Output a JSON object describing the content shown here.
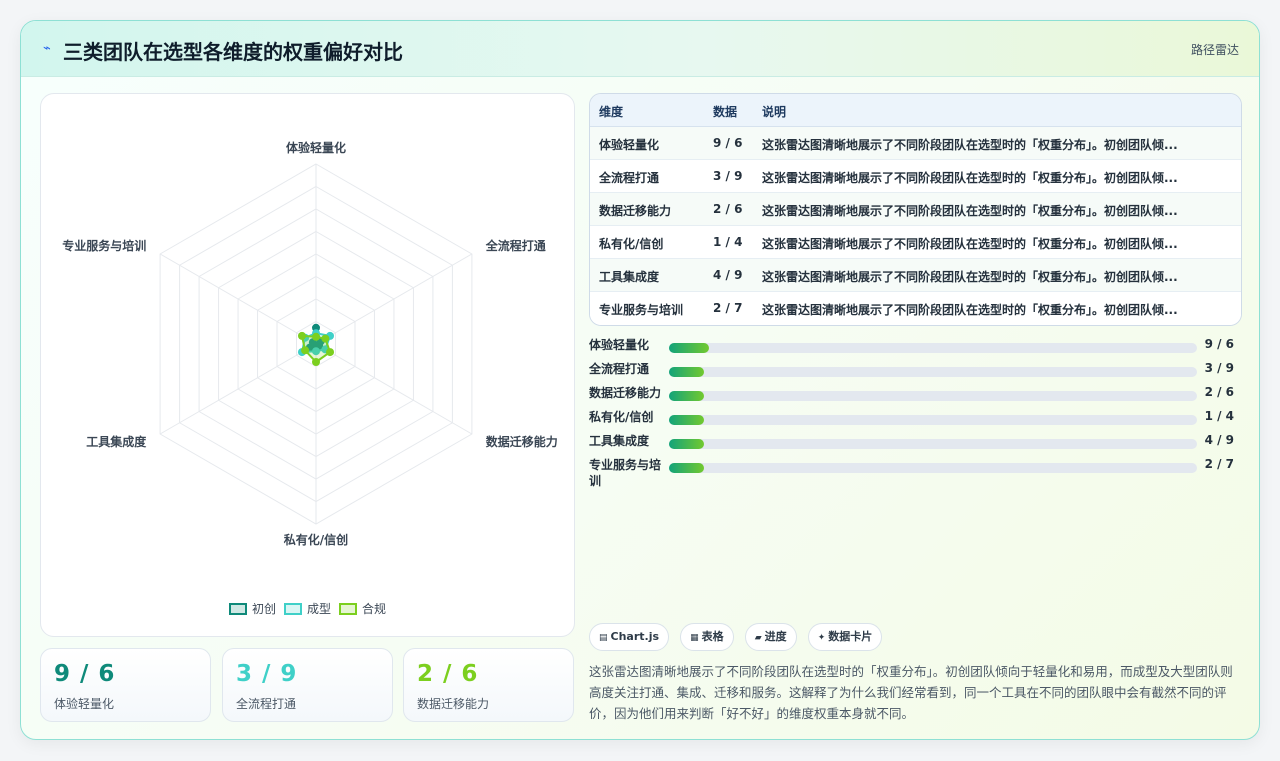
{
  "header": {
    "logo": "⌁",
    "title": "三类团队在选型各维度的权重偏好对比",
    "tag": "路径雷达"
  },
  "colors": {
    "accent": "#0f9d8a",
    "series": [
      "#0f8a7a",
      "#3fd0c8",
      "#7ccf1f"
    ]
  },
  "chart_data": {
    "type": "radar",
    "labels": [
      "体验轻量化",
      "全流程打通",
      "数据迁移能力",
      "私有化/信创",
      "工具集成度",
      "专业服务与培训"
    ],
    "series": [
      {
        "name": "初创",
        "values": [
          9,
          3,
          2,
          1,
          4,
          2
        ]
      },
      {
        "name": "成型",
        "values": [
          6,
          9,
          6,
          4,
          9,
          7
        ]
      },
      {
        "name": "合规",
        "values": [
          4,
          6,
          9,
          10,
          7,
          9
        ]
      }
    ],
    "r_range": [
      0,
      100
    ],
    "grid_levels": 8,
    "legend_position": "bottom"
  },
  "stats": [
    {
      "value": "9 / 6",
      "label": "体验轻量化"
    },
    {
      "value": "3 / 9",
      "label": "全流程打通"
    },
    {
      "value": "2 / 6",
      "label": "数据迁移能力"
    }
  ],
  "table": {
    "headers": [
      "维度",
      "数据",
      "说明"
    ],
    "rows": [
      {
        "dim": "体验轻量化",
        "data": "9 / 6",
        "note": "这张雷达图清晰地展示了不同阶段团队在选型时的「权重分布」。初创团队倾..."
      },
      {
        "dim": "全流程打通",
        "data": "3 / 9",
        "note": "这张雷达图清晰地展示了不同阶段团队在选型时的「权重分布」。初创团队倾..."
      },
      {
        "dim": "数据迁移能力",
        "data": "2 / 6",
        "note": "这张雷达图清晰地展示了不同阶段团队在选型时的「权重分布」。初创团队倾..."
      },
      {
        "dim": "私有化/信创",
        "data": "1 / 4",
        "note": "这张雷达图清晰地展示了不同阶段团队在选型时的「权重分布」。初创团队倾..."
      },
      {
        "dim": "工具集成度",
        "data": "4 / 9",
        "note": "这张雷达图清晰地展示了不同阶段团队在选型时的「权重分布」。初创团队倾..."
      },
      {
        "dim": "专业服务与培训",
        "data": "2 / 7",
        "note": "这张雷达图清晰地展示了不同阶段团队在选型时的「权重分布」。初创团队倾..."
      }
    ]
  },
  "bars": [
    {
      "label": "体验轻量化",
      "value": "9 / 6",
      "progress": 0.075
    },
    {
      "label": "全流程打通",
      "value": "3 / 9",
      "progress": 0.067
    },
    {
      "label": "数据迁移能力",
      "value": "2 / 6",
      "progress": 0.067
    },
    {
      "label": "私有化/信创",
      "value": "1 / 4",
      "progress": 0.067
    },
    {
      "label": "工具集成度",
      "value": "4 / 9",
      "progress": 0.067
    },
    {
      "label": "专业服务与培训",
      "value": "2 / 7",
      "progress": 0.067
    }
  ],
  "chips": [
    {
      "icon": "▤",
      "label": "Chart.js"
    },
    {
      "icon": "▦",
      "label": "表格"
    },
    {
      "icon": "▰",
      "label": "进度"
    },
    {
      "icon": "✦",
      "label": "数据卡片"
    }
  ],
  "description": "这张雷达图清晰地展示了不同阶段团队在选型时的「权重分布」。初创团队倾向于轻量化和易用，而成型及大型团队则高度关注打通、集成、迁移和服务。这解释了为什么我们经常看到，同一个工具在不同的团队眼中会有截然不同的评价，因为他们用来判断「好不好」的维度权重本身就不同。"
}
